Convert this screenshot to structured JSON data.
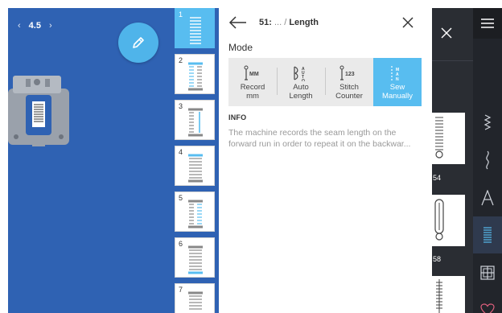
{
  "stitch_preview": {
    "width_value": "4.5",
    "decrease_label": "‹",
    "increase_label": "›",
    "edit_icon": "pencil-icon"
  },
  "steps": [
    {
      "num": "1",
      "active": true
    },
    {
      "num": "2",
      "active": false
    },
    {
      "num": "3",
      "active": false
    },
    {
      "num": "4",
      "active": false
    },
    {
      "num": "5",
      "active": false
    },
    {
      "num": "6",
      "active": false
    },
    {
      "num": "7",
      "active": false
    }
  ],
  "panel": {
    "crumb_number": "51:",
    "crumb_ellipsis": "...",
    "crumb_separator": "/",
    "crumb_title": "Length",
    "mode_heading": "Mode",
    "modes": [
      {
        "icon": "record-mm-icon",
        "icon_text": "MM",
        "line1": "Record",
        "line2": "mm",
        "active": false
      },
      {
        "icon": "auto-length-icon",
        "icon_text": "AUTO",
        "line1": "Auto",
        "line2": "Length",
        "active": false
      },
      {
        "icon": "stitch-counter-icon",
        "icon_text": "123",
        "line1": "Stitch",
        "line2": "Counter",
        "active": false
      },
      {
        "icon": "sew-manually-icon",
        "icon_text": "MAN",
        "line1": "Sew",
        "line2": "Manually",
        "active": true
      }
    ],
    "info_heading": "INFO",
    "info_line1": "The machine records the seam length on the",
    "info_line2": "forward run in order to repeat it on the backwar..."
  },
  "right_panel": {
    "card_labels": [
      "54",
      "58"
    ]
  },
  "colors": {
    "accent": "#58bdf0",
    "preview_bg": "#2f62b3",
    "dark_sidebar": "#2a2d33",
    "category_bar": "#22252b"
  }
}
